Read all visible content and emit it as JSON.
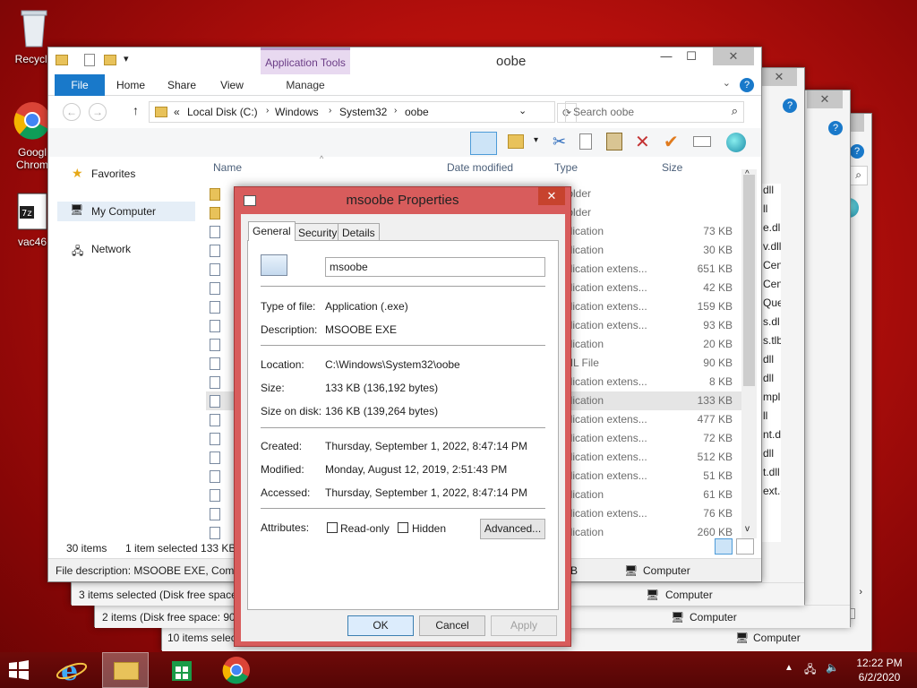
{
  "desktop": {
    "recycle_label": "Recycle",
    "chrome_label_1": "Googl",
    "chrome_label_2": "Chrom",
    "vac_label": "vac46"
  },
  "explorer": {
    "title": "oobe",
    "app_tools": "Application Tools",
    "ribbon_tabs": [
      "File",
      "Home",
      "Share",
      "View",
      "Manage"
    ],
    "breadcrumb": [
      "Local Disk (C:)",
      "Windows",
      "System32",
      "oobe"
    ],
    "search_placeholder": "Search oobe",
    "nav": {
      "favorites": "Favorites",
      "my_computer": "My Computer",
      "network": "Network"
    },
    "columns": {
      "name": "Name",
      "date": "Date modified",
      "type": "Type",
      "size": "Size"
    },
    "rows": [
      {
        "type": "folder",
        "size": ""
      },
      {
        "type": "folder",
        "size": ""
      },
      {
        "type": "plication",
        "size": "73 KB"
      },
      {
        "type": "plication",
        "size": "30 KB"
      },
      {
        "type": "plication extens...",
        "size": "651 KB"
      },
      {
        "type": "plication extens...",
        "size": "42 KB"
      },
      {
        "type": "plication extens...",
        "size": "159 KB"
      },
      {
        "type": "plication extens...",
        "size": "93 KB"
      },
      {
        "type": "plication",
        "size": "20 KB"
      },
      {
        "type": "ML File",
        "size": "90 KB"
      },
      {
        "type": "plication extens...",
        "size": "8 KB"
      },
      {
        "type": "plication",
        "size": "133 KB"
      },
      {
        "type": "plication extens...",
        "size": "477 KB"
      },
      {
        "type": "plication extens...",
        "size": "72 KB"
      },
      {
        "type": "plication extens...",
        "size": "512 KB"
      },
      {
        "type": "plication extens...",
        "size": "51 KB"
      },
      {
        "type": "plication",
        "size": "61 KB"
      },
      {
        "type": "plication extens...",
        "size": "76 KB"
      },
      {
        "type": "plication",
        "size": "260 KB"
      }
    ],
    "status_items": "30 items",
    "status_selected": "1 item selected  133 KB",
    "details_bar": "File description: MSOOBE EXE, Compa",
    "details_bar_right": "B",
    "computer": "Computer"
  },
  "bg_windows": {
    "status1": "3 items selected (Disk free space:",
    "status2": "2 items (Disk free space: 90.3",
    "status3": "10 items select",
    "computer": "Computer",
    "fragments": [
      "dll",
      "ll",
      "e.dl",
      "v.dll",
      "Cen",
      "Cen",
      "Que",
      "s.dl",
      "s.tlb",
      "dll",
      "dll",
      "mpl.",
      "ll",
      "nt.d",
      "dll",
      "t.dll",
      "ext.c"
    ]
  },
  "dialog": {
    "title": "msoobe Properties",
    "tabs": [
      "General",
      "Security",
      "Details"
    ],
    "filename": "msoobe",
    "type_of_file_label": "Type of file:",
    "type_of_file": "Application (.exe)",
    "description_label": "Description:",
    "description": "MSOOBE EXE",
    "location_label": "Location:",
    "location": "C:\\Windows\\System32\\oobe",
    "size_label": "Size:",
    "size": "133 KB (136,192 bytes)",
    "size_on_disk_label": "Size on disk:",
    "size_on_disk": "136 KB (139,264 bytes)",
    "created_label": "Created:",
    "created": "Thursday, September 1, 2022, 8:47:14 PM",
    "modified_label": "Modified:",
    "modified": "Monday, August 12, 2019, 2:51:43 PM",
    "accessed_label": "Accessed:",
    "accessed": "Thursday, September 1, 2022, 8:47:14 PM",
    "attributes_label": "Attributes:",
    "readonly_label": "Read-only",
    "hidden_label": "Hidden",
    "advanced_label": "Advanced...",
    "ok_label": "OK",
    "cancel_label": "Cancel",
    "apply_label": "Apply"
  },
  "taskbar": {
    "time": "12:22 PM",
    "date": "6/2/2020"
  },
  "colors": {
    "accent": "#1979ca",
    "dialog_frame": "#d85c5c",
    "app_tools": "#e8d9f0"
  }
}
